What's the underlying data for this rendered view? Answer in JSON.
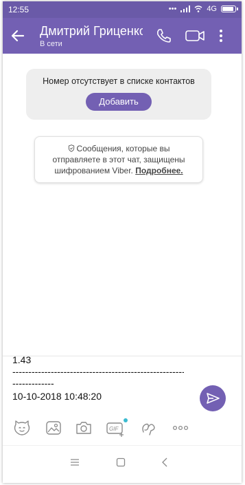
{
  "status_bar": {
    "time": "12:55",
    "indicators": "... 4G",
    "battery_level": 0.9,
    "icons": [
      "dots-icon",
      "signal-icon",
      "wifi-icon",
      "battery-icon"
    ]
  },
  "header": {
    "contact_name": "Дмитрий Гриценко",
    "status": "В сети",
    "back_icon": "arrow-left-icon",
    "call_icon": "phone-icon",
    "video_icon": "video-camera-icon",
    "menu_icon": "more-vertical-icon",
    "color": "#7360b3"
  },
  "contact_notice": {
    "text": "Номер отсутствует в списке контактов",
    "add_label": "Добавить"
  },
  "encryption_notice": {
    "line1": "Сообщения, которые вы",
    "line2": "отправляете в этот чат, защищены",
    "line3_prefix": "шифрованием Viber. ",
    "more_link": "Подробнее.",
    "icon": "shield-icon"
  },
  "message_input": {
    "lines": [
      "1.43",
      "-------------------------------------------------------------",
      "-------------",
      "10-10-2018 10:48:20"
    ]
  },
  "send_button": {
    "icon": "send-icon"
  },
  "toolbar": {
    "items": [
      "sticker-icon",
      "gallery-icon",
      "camera-icon",
      "gif-icon",
      "doodle-icon",
      "more-horizontal-icon"
    ]
  },
  "nav_bar": {
    "items": [
      "menu-icon",
      "home-icon",
      "back-icon"
    ]
  }
}
